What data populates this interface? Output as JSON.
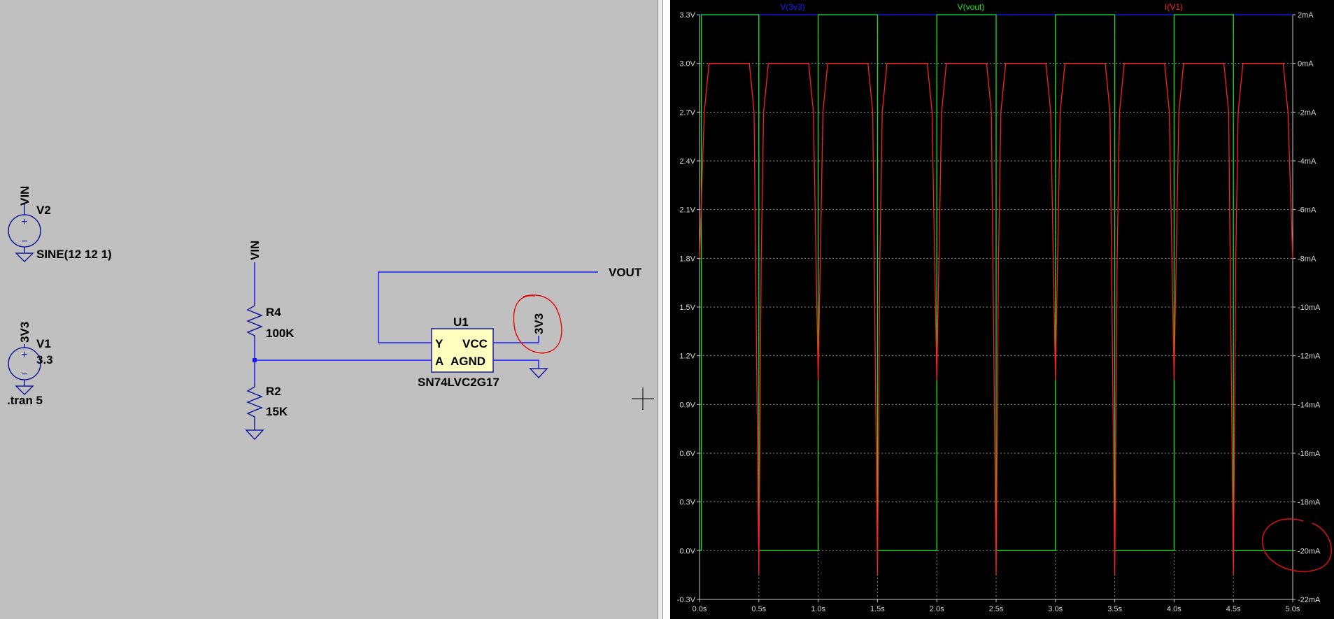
{
  "schematic": {
    "v2": {
      "name": "V2",
      "net": "VIN",
      "value": "SINE(12 12 1)"
    },
    "v1": {
      "name": "V1",
      "net": "3V3",
      "value": "3.3"
    },
    "directive": ".tran 5",
    "divider_top_net": "VIN",
    "r4": {
      "name": "R4",
      "value": "100K"
    },
    "r2": {
      "name": "R2",
      "value": "15K"
    },
    "u1": {
      "name": "U1",
      "part": "SN74LVC2G17",
      "pin_y": "Y",
      "pin_a": "A",
      "pin_vcc": "VCC",
      "pin_agnd": "AGND"
    },
    "vout_net": "VOUT",
    "vcc_net": "3V3",
    "colors": {
      "wire": "#1a1aff",
      "component": "#1a1a9a",
      "annotation": "#e01010",
      "part_fill": "#ffffc0"
    }
  },
  "plot": {
    "traces": [
      {
        "name": "V(3v3)",
        "color": "#1818ff"
      },
      {
        "name": "V(vout)",
        "color": "#19e019"
      },
      {
        "name": "I(V1)",
        "color": "#ff2020"
      }
    ],
    "left_ticks": [
      "3.3V",
      "3.0V",
      "2.7V",
      "2.4V",
      "2.1V",
      "1.8V",
      "1.5V",
      "1.2V",
      "0.9V",
      "0.6V",
      "0.3V",
      "0.0V",
      "-0.3V"
    ],
    "right_ticks": [
      "2mA",
      "0mA",
      "-2mA",
      "-4mA",
      "-6mA",
      "-8mA",
      "-10mA",
      "-12mA",
      "-14mA",
      "-16mA",
      "-18mA",
      "-20mA",
      "-22mA"
    ],
    "x_ticks": [
      "0.0s",
      "0.5s",
      "1.0s",
      "1.5s",
      "2.0s",
      "2.5s",
      "3.0s",
      "3.5s",
      "4.0s",
      "4.5s",
      "5.0s"
    ],
    "colors": {
      "grid": "#8a8a8a",
      "axis": "#c8c8c8"
    }
  },
  "chart_data": {
    "type": "line",
    "xlabel": "",
    "xlim": [
      0,
      5
    ],
    "ylim_left": [
      -0.3,
      3.3
    ],
    "ylim_right": [
      -22,
      2
    ],
    "grid": true,
    "series": [
      {
        "name": "V(3v3)",
        "axis": "left",
        "x": [
          0,
          5
        ],
        "y": [
          3.3,
          3.3
        ]
      },
      {
        "name": "V(vout)",
        "axis": "left",
        "x": [
          0,
          0.015,
          0.015,
          0.5,
          0.5,
          1.0,
          1.0,
          1.5,
          1.5,
          2.0,
          2.0,
          2.5,
          2.5,
          3.0,
          3.0,
          3.5,
          3.5,
          4.0,
          4.0,
          4.5,
          4.5,
          5.0
        ],
        "y": [
          0,
          0,
          3.3,
          3.3,
          0,
          0,
          3.3,
          3.3,
          0,
          0,
          3.3,
          3.3,
          0,
          0,
          3.3,
          3.3,
          0,
          0,
          3.3,
          3.3,
          0,
          0
        ]
      },
      {
        "name": "I(V1)",
        "axis": "right",
        "x": [
          0,
          0.04,
          0.08,
          0.42,
          0.46,
          0.5,
          0.52,
          0.54,
          0.58,
          0.92,
          0.96,
          1.0,
          1.04,
          1.08,
          1.42,
          1.46,
          1.5,
          1.52,
          1.54,
          1.58,
          1.92,
          1.96,
          2.0,
          2.04,
          2.08,
          2.42,
          2.46,
          2.5,
          2.52,
          2.54,
          2.58,
          2.92,
          2.96,
          3.0,
          3.04,
          3.08,
          3.42,
          3.46,
          3.5,
          3.52,
          3.54,
          3.58,
          3.92,
          3.96,
          4.0,
          4.04,
          4.08,
          4.42,
          4.46,
          4.5,
          4.52,
          4.54,
          4.58,
          4.92,
          4.96,
          5.0
        ],
        "y": [
          -8,
          -2,
          0,
          0,
          -2,
          -21,
          -8,
          -2,
          0,
          0,
          -2,
          -13,
          -2,
          0,
          0,
          -2,
          -21,
          -8,
          -2,
          0,
          0,
          -2,
          -13,
          -2,
          0,
          0,
          -2,
          -21,
          -8,
          -2,
          0,
          0,
          -2,
          -13,
          -2,
          0,
          0,
          -2,
          -21,
          -8,
          -2,
          0,
          0,
          -2,
          -13,
          -2,
          0,
          0,
          -2,
          -21,
          -8,
          -2,
          0,
          0,
          -2,
          -8
        ]
      }
    ]
  }
}
